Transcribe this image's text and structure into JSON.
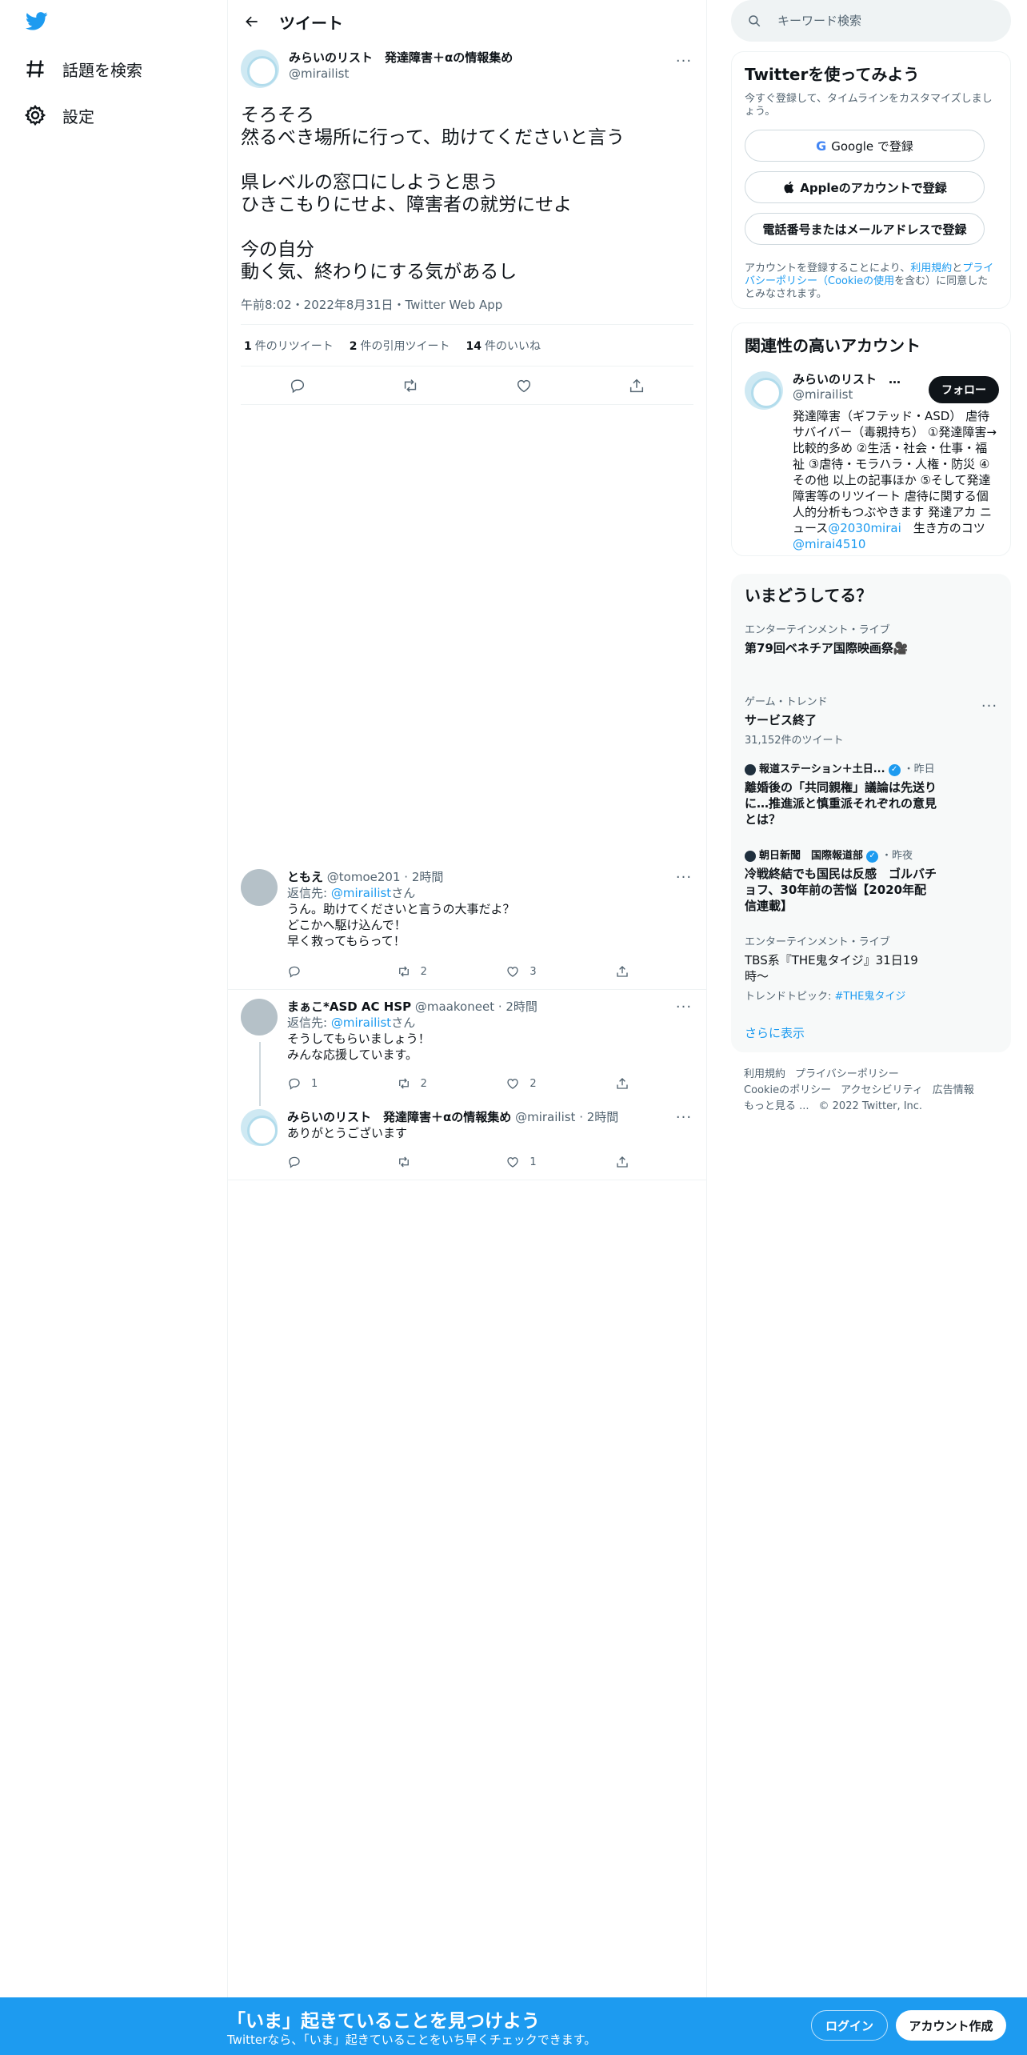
{
  "nav": {
    "explore_label": "話題を検索",
    "settings_label": "設定"
  },
  "header": {
    "title": "ツイート"
  },
  "tweet": {
    "display_name": "みらいのリスト　発達障害＋αの情報集め",
    "handle": "@mirailist",
    "text": "そろそろ\n然るべき場所に行って、助けてくださいと言う\n\n県レベルの窓口にしようと思う\nひきこもりにせよ、障害者の就労にせよ\n\n今の自分\n動く気、終わりにする気があるし",
    "meta": "午前8:02・2022年8月31日・Twitter Web App",
    "retweets_count": "1",
    "retweets_label": "件のリツイート",
    "quotes_count": "2",
    "quotes_label": "件の引用ツイート",
    "likes_count": "14",
    "likes_label": "件のいいね"
  },
  "replies": [
    {
      "name": "ともえ",
      "handle": "@tomoe201",
      "time": "2時間",
      "to_prefix": "返信先:",
      "to_handle": "@mirailist",
      "to_suffix": "さん",
      "text": "うん。助けてくださいと言うの大事だよ？\nどこかへ駆け込んで！\n早く救ってもらって！",
      "reply_count": "",
      "retweet_count": "2",
      "like_count": "3"
    },
    {
      "name": "まぁこ*ASD AC HSP",
      "handle": "@maakoneet",
      "time": "2時間",
      "to_prefix": "返信先:",
      "to_handle": "@mirailist",
      "to_suffix": "さん",
      "text": "そうしてもらいましょう！\nみんな応援しています。",
      "reply_count": "1",
      "retweet_count": "2",
      "like_count": "2"
    },
    {
      "name": "みらいのリスト　発達障害＋αの情報集め",
      "handle": "@mirailist",
      "time": "2時間",
      "text": "ありがとうございます",
      "reply_count": "",
      "retweet_count": "",
      "like_count": "1"
    }
  ],
  "search": {
    "placeholder": "キーワード検索"
  },
  "signup_card": {
    "title": "Twitterを使ってみよう",
    "subtitle": "今すぐ登録して、タイムラインをカスタマイズしましょう。",
    "google_label": "Google で登録",
    "apple_label": "Appleのアカウントで登録",
    "phone_label": "電話番号またはメールアドレスで登録",
    "legal_1": "アカウントを登録することにより、",
    "legal_terms": "利用規約",
    "legal_and": "と",
    "legal_privacy": "プライバシーポリシー",
    "legal_paren_open": "（",
    "legal_cookie": "Cookieの使用",
    "legal_2": "を含む）に同意したとみなされます。"
  },
  "related": {
    "title": "関連性の高いアカウント",
    "name": "みらいのリスト　発達障害＋αの情報集め",
    "handle": "@mirailist",
    "follow_label": "フォロー",
    "bio": "発達障害（ギフテッド・ASD） 虐待サバイバー（毒親持ち） ①発達障害→　比較的多め ②生活・社会・仕事・福祉 ③虐待・モラハラ・人権・防災 ④その他 以上の記事ほか ⑤そして発達障害等のリツイート 虐待に関する個人的分析もつぶやきます 発達アカ ニュース",
    "bio_link1": "@2030mirai",
    "bio_mid": "　生き方のコツ　",
    "bio_link2": "@mirai4510"
  },
  "trends": {
    "title": "いまどうしてる？",
    "items": [
      {
        "category": "エンターテインメント・ライブ",
        "title": "第79回ベネチア国際映画祭🎥"
      },
      {
        "category": "ゲーム・トレンド",
        "title": "サービス終了",
        "count": "31,152件のツイート"
      },
      {
        "source": "報道ステーション＋土日...",
        "time": "・昨日",
        "title": "離婚後の「共同親権」議論は先送りに…推進派と慎重派それぞれの意見とは？"
      },
      {
        "source": "朝日新聞　国際報道部",
        "time": "・昨夜",
        "title": "冷戦終結でも国民は反感　ゴルバチョフ、30年前の苦悩【2020年配信連載】"
      },
      {
        "category": "エンターテインメント・ライブ",
        "title": "TBS系『THE鬼タイジ』31日19時〜",
        "topic_prefix": "トレンドトピック:",
        "topic": "#THE鬼タイジ"
      }
    ],
    "show_more": "さらに表示"
  },
  "footer": {
    "terms": "利用規約",
    "privacy": "プライバシーポリシー",
    "cookie": "Cookieのポリシー",
    "accessibility": "アクセシビリティ",
    "ads": "広告情報",
    "more": "もっと見る ...",
    "copyright": "© 2022 Twitter, Inc."
  },
  "bottom_bar": {
    "title": "「いま」起きていることを見つけよう",
    "subtitle": "Twitterなら、「いま」起きていることをいち早くチェックできます。",
    "login_label": "ログイン",
    "signup_label": "アカウント作成"
  },
  "colors": {
    "accent": "#1d9bf0",
    "text": "#0f1419",
    "muted": "#536471",
    "border": "#eff3f4"
  }
}
